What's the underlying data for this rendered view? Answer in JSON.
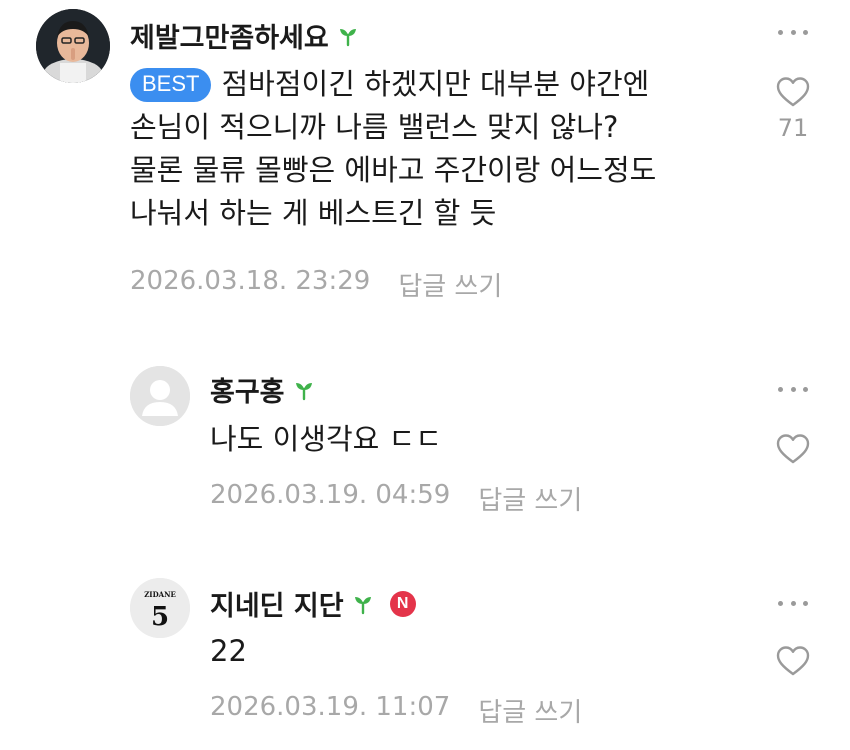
{
  "comments": [
    {
      "author": "제발그만좀하세요",
      "best_label": "BEST",
      "lines": [
        "점바점이긴 하겠지만 대부분 야간엔",
        "손님이 적으니까 나름 밸런스 맞지 않나?",
        "물론 물류 몰빵은 에바고 주간이랑 어느정도",
        "나눠서 하는 게 베스트긴 할 듯"
      ],
      "timestamp": "2026.03.18. 23:29",
      "reply_label": "답글 쓰기",
      "likes": "71"
    },
    {
      "author": "홍구홍",
      "lines": [
        "나도 이생각요 ㄷㄷ"
      ],
      "timestamp": "2026.03.19. 04:59",
      "reply_label": "답글 쓰기"
    },
    {
      "author": "지네딘 지단",
      "new_badge": "N",
      "avatar_text_top": "ZIDANE",
      "avatar_text_num": "5",
      "lines": [
        "22"
      ],
      "timestamp": "2026.03.19. 11:07",
      "reply_label": "답글 쓰기"
    }
  ],
  "icons": {
    "verified": "sprout-icon",
    "more": "more-dots-icon",
    "like": "heart-icon"
  },
  "colors": {
    "best_badge": "#3b8ef0",
    "sprout": "#3fb24b",
    "new_badge": "#e4344a",
    "meta_text": "#a8a8a8"
  }
}
